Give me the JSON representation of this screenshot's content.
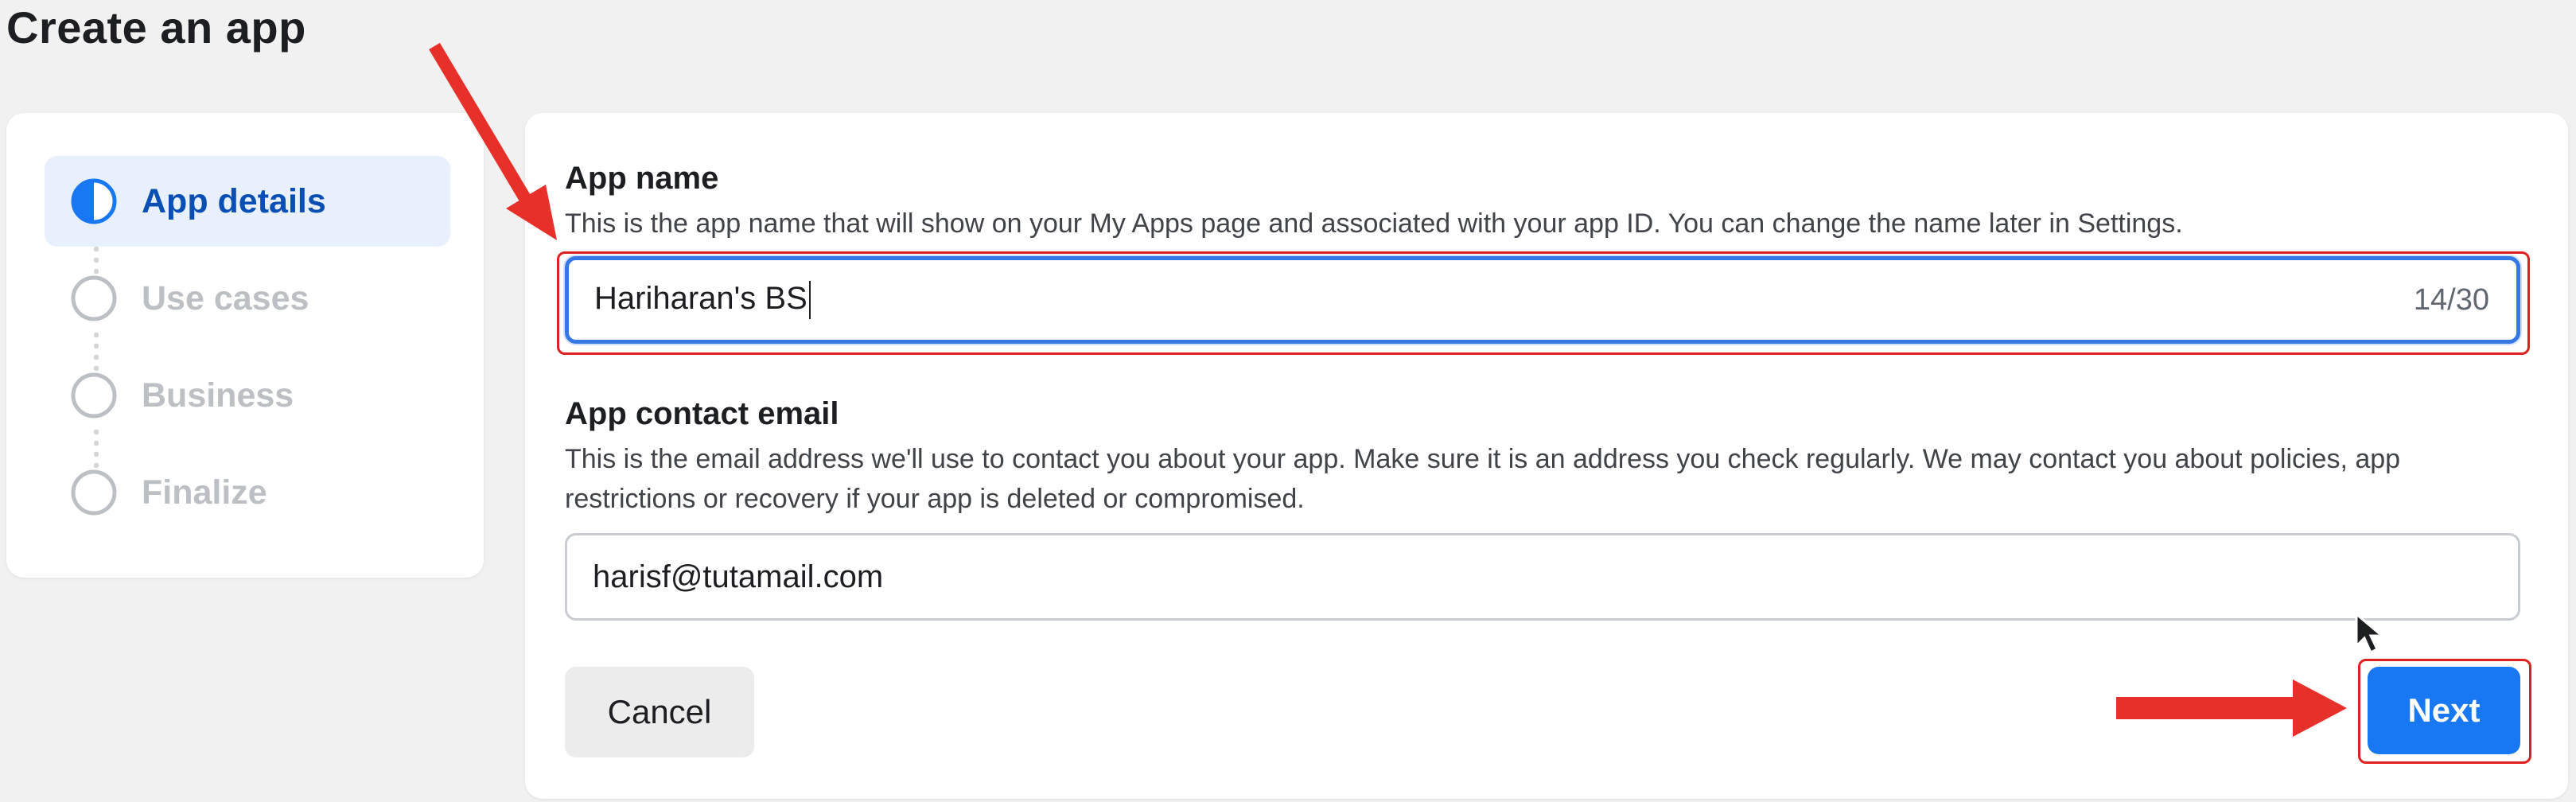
{
  "page": {
    "title": "Create an app"
  },
  "stepper": {
    "steps": [
      {
        "label": "App details",
        "state": "active"
      },
      {
        "label": "Use cases",
        "state": "inactive"
      },
      {
        "label": "Business",
        "state": "inactive"
      },
      {
        "label": "Finalize",
        "state": "inactive"
      }
    ]
  },
  "form": {
    "app_name": {
      "title": "App name",
      "description": "This is the app name that will show on your My Apps page and associated with your app ID. You can change the name later in Settings.",
      "value": "Hariharan's BS",
      "counter": "14/30"
    },
    "contact_email": {
      "title": "App contact email",
      "description": "This is the email address we'll use to contact you about your app. Make sure it is an address you check regularly. We may contact you about policies, app restrictions or recovery if your app is deleted or compromised.",
      "value": "harisf@tutamail.com"
    },
    "cancel_label": "Cancel",
    "next_label": "Next"
  },
  "colors": {
    "accent": "#1877f2",
    "active_step_bg": "#e8f0fd",
    "annotation_red": "#e02020"
  },
  "icons": [
    "half-circle-progress-icon",
    "empty-circle-icon",
    "arrow-annotation-icon",
    "mouse-cursor-icon"
  ]
}
